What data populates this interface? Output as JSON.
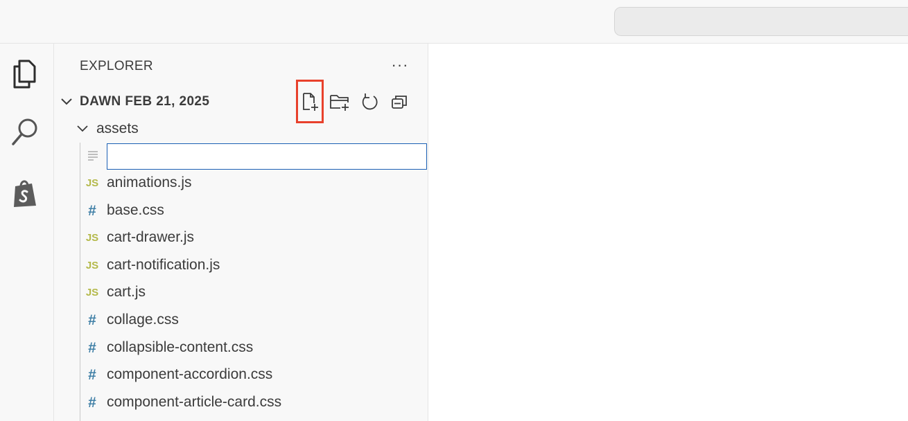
{
  "explorer": {
    "header": "EXPLORER",
    "more": "···",
    "workspace_title": "DAWN FEB 21, 2025",
    "folder": "assets",
    "new_file_value": "",
    "files": [
      {
        "name": "animations.js",
        "type": "js",
        "icon": "JS"
      },
      {
        "name": "base.css",
        "type": "css",
        "icon": "#"
      },
      {
        "name": "cart-drawer.js",
        "type": "js",
        "icon": "JS"
      },
      {
        "name": "cart-notification.js",
        "type": "js",
        "icon": "JS"
      },
      {
        "name": "cart.js",
        "type": "js",
        "icon": "JS"
      },
      {
        "name": "collage.css",
        "type": "css",
        "icon": "#"
      },
      {
        "name": "collapsible-content.css",
        "type": "css",
        "icon": "#"
      },
      {
        "name": "component-accordion.css",
        "type": "css",
        "icon": "#"
      },
      {
        "name": "component-article-card.css",
        "type": "css",
        "icon": "#"
      }
    ]
  },
  "toolbar_icons": [
    "new-file-icon",
    "new-folder-icon",
    "refresh-icon",
    "collapse-all-icon"
  ],
  "activity_icons": [
    "explorer-icon",
    "search-icon",
    "shopify-icon"
  ],
  "colors": {
    "js_icon": "#b4b94a",
    "css_icon": "#3f7fa6",
    "highlight": "#e8412c",
    "input_border": "#1a5fb4"
  }
}
